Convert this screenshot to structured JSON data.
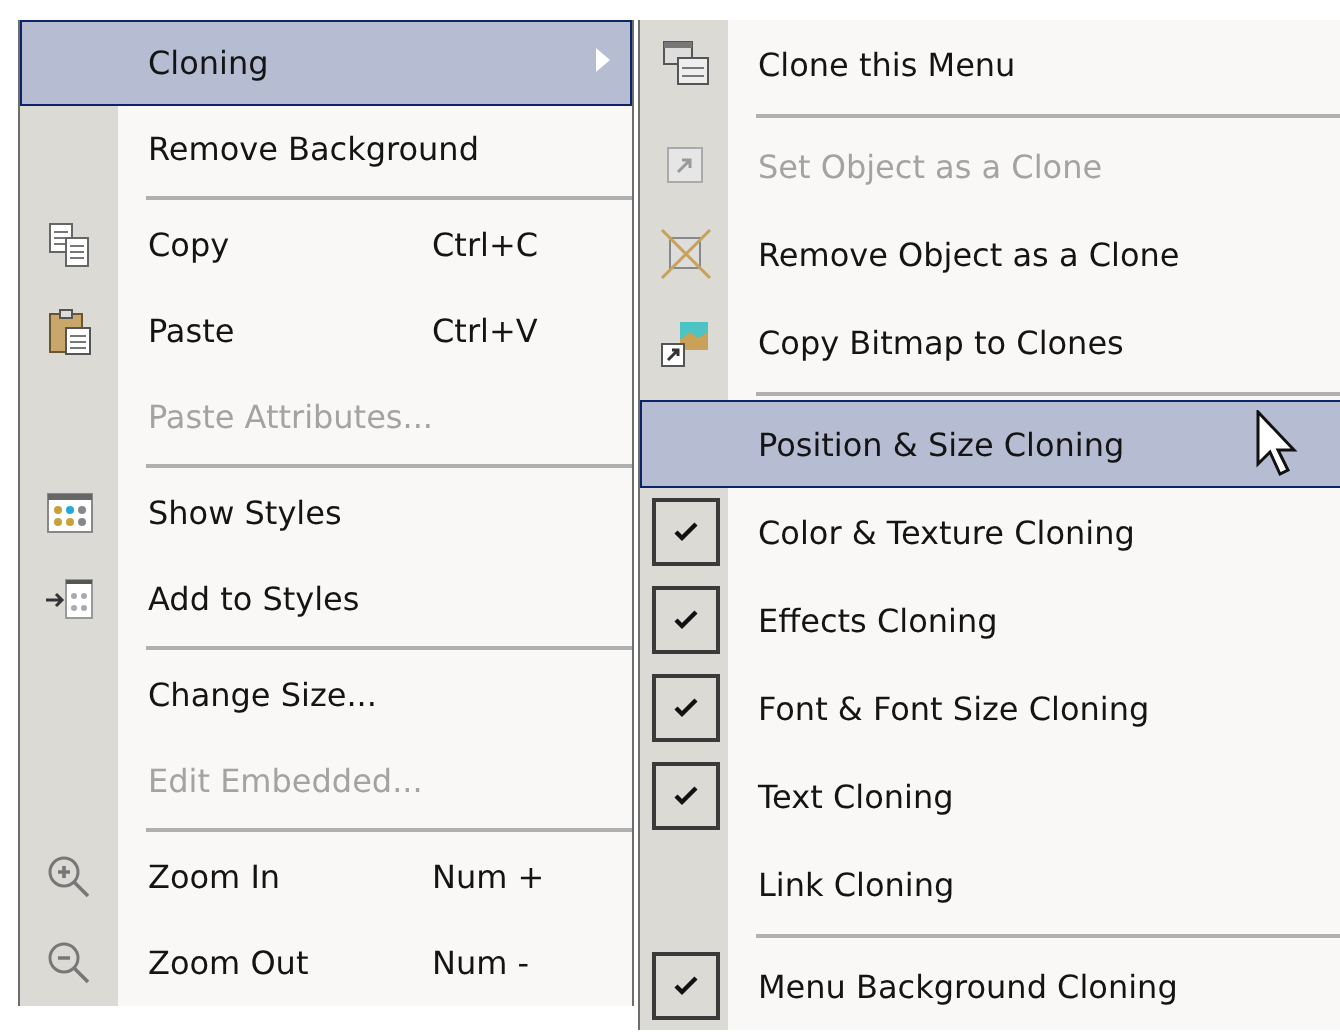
{
  "context_menu": {
    "items": [
      {
        "kind": "item",
        "label": "Cloning",
        "selected": true,
        "disabled": false,
        "has_submenu": true
      },
      {
        "kind": "item",
        "label": "Remove Background",
        "selected": false,
        "disabled": false
      },
      {
        "kind": "separator"
      },
      {
        "kind": "item",
        "label": "Copy",
        "shortcut": "Ctrl+C",
        "selected": false,
        "disabled": false
      },
      {
        "kind": "item",
        "label": "Paste",
        "shortcut": "Ctrl+V",
        "selected": false,
        "disabled": false
      },
      {
        "kind": "item",
        "label": "Paste Attributes...",
        "selected": false,
        "disabled": true
      },
      {
        "kind": "separator"
      },
      {
        "kind": "item",
        "label": "Show Styles",
        "selected": false,
        "disabled": false
      },
      {
        "kind": "item",
        "label": "Add to Styles",
        "selected": false,
        "disabled": false
      },
      {
        "kind": "separator"
      },
      {
        "kind": "item",
        "label": "Change Size...",
        "selected": false,
        "disabled": false
      },
      {
        "kind": "item",
        "label": "Edit Embedded...",
        "selected": false,
        "disabled": true
      },
      {
        "kind": "separator"
      },
      {
        "kind": "item",
        "label": "Zoom In",
        "shortcut": "Num +",
        "selected": false,
        "disabled": false
      },
      {
        "kind": "item",
        "label": "Zoom Out",
        "shortcut": "Num -",
        "selected": false,
        "disabled": false
      }
    ]
  },
  "submenu": {
    "items": [
      {
        "kind": "item",
        "label": "Clone this Menu",
        "selected": false,
        "disabled": false,
        "checked": false
      },
      {
        "kind": "separator"
      },
      {
        "kind": "item",
        "label": "Set Object as a Clone",
        "selected": false,
        "disabled": true,
        "checked": false
      },
      {
        "kind": "item",
        "label": "Remove Object as a Clone",
        "selected": false,
        "disabled": false,
        "checked": false
      },
      {
        "kind": "item",
        "label": "Copy Bitmap to Clones",
        "selected": false,
        "disabled": false,
        "checked": false
      },
      {
        "kind": "separator"
      },
      {
        "kind": "item",
        "label": "Position & Size Cloning",
        "selected": true,
        "disabled": false,
        "checked": false
      },
      {
        "kind": "item",
        "label": "Color & Texture Cloning",
        "selected": false,
        "disabled": false,
        "checked": true
      },
      {
        "kind": "item",
        "label": "Effects Cloning",
        "selected": false,
        "disabled": false,
        "checked": true
      },
      {
        "kind": "item",
        "label": "Font & Font Size Cloning",
        "selected": false,
        "disabled": false,
        "checked": true
      },
      {
        "kind": "item",
        "label": "Text Cloning",
        "selected": false,
        "disabled": false,
        "checked": true
      },
      {
        "kind": "item",
        "label": "Link Cloning",
        "selected": false,
        "disabled": false,
        "checked": false
      },
      {
        "kind": "separator"
      },
      {
        "kind": "item",
        "label": "Menu Background Cloning",
        "selected": false,
        "disabled": false,
        "checked": true
      }
    ]
  }
}
